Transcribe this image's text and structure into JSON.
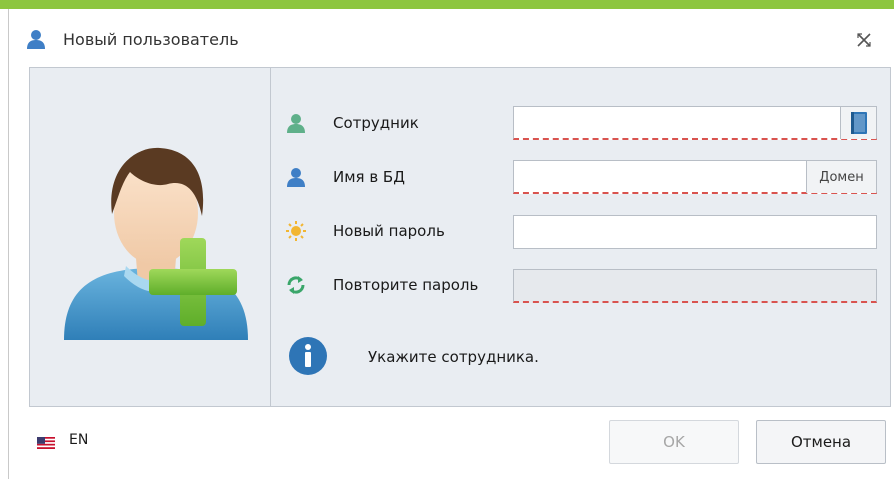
{
  "window": {
    "title": "Новый пользователь",
    "title_icon": "user-icon",
    "close_icon": "close-icon"
  },
  "colors": {
    "accent_bar": "#8dc63f",
    "panel_bg": "#e9edf2",
    "error_underline": "#d9534f",
    "info_blue": "#2e75b6"
  },
  "avatar": {
    "icon": "add-user-avatar-icon"
  },
  "form": {
    "employee_label": "Сотрудник",
    "employee_value": "",
    "employee_icon": "employee-icon",
    "lookup_icon": "book-icon",
    "db_name_label": "Имя в БД",
    "db_name_value": "",
    "db_name_icon": "user-icon",
    "domain_button": "Домен",
    "new_password_label": "Новый пароль",
    "new_password_value": "",
    "new_password_icon": "password-icon",
    "repeat_password_label": "Повторите пароль",
    "repeat_password_value": "",
    "repeat_password_icon": "refresh-icon"
  },
  "info": {
    "icon": "info-icon",
    "message": "Укажите сотрудника."
  },
  "footer": {
    "language_flag": "us-flag-icon",
    "language": "EN",
    "ok_label": "OK",
    "cancel_label": "Отмена"
  }
}
